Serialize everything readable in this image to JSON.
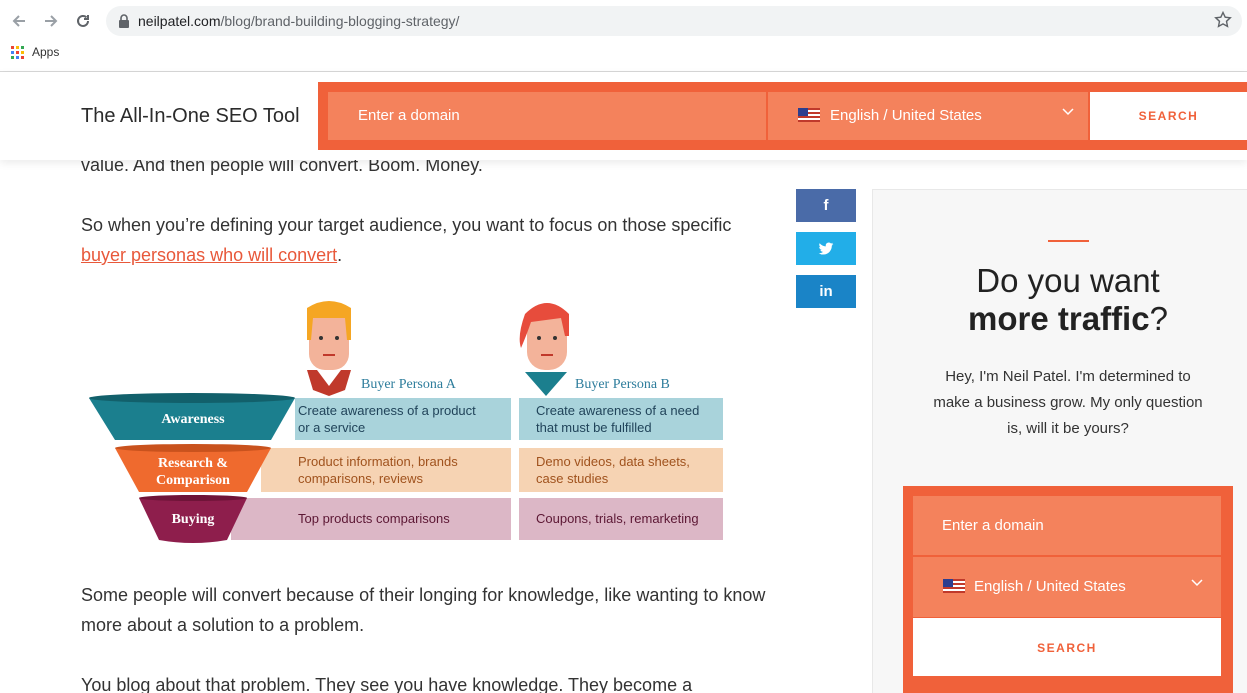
{
  "browser": {
    "url_domain": "neilpatel.com",
    "url_path": "/blog/brand-building-blogging-strategy/",
    "bookmark_apps": "Apps"
  },
  "header": {
    "brand": "The All-In-One SEO Tool",
    "domain_placeholder": "Enter a domain",
    "language": "English / United States",
    "search_label": "SEARCH"
  },
  "article": {
    "p1": "value. And then people will convert. Boom. Money.",
    "p2_text": "So when you’re defining your target audience, you want to focus on those specific ",
    "p2_link": "buyer personas who will convert",
    "p2_end": ".",
    "p3": "Some people will convert because of their longing for knowledge, like wanting to know more about a solution to a problem.",
    "p4": "You blog about that problem. They see you have knowledge. They become a"
  },
  "graphic": {
    "persona_a": "Buyer Persona A",
    "persona_b": "Buyer Persona B",
    "stages": [
      {
        "label_1": "Awareness",
        "label_2": "",
        "a_1": "Create awareness of a product",
        "a_2": "or a service",
        "b_1": "Create awareness of a need",
        "b_2": "that must be fulfilled"
      },
      {
        "label_1": "Research &",
        "label_2": "Comparison",
        "a_1": "Product information, brands",
        "a_2": "comparisons, reviews",
        "b_1": "Demo videos, data sheets,",
        "b_2": "case studies"
      },
      {
        "label_1": "Buying",
        "label_2": "",
        "a_1": "Top products comparisons",
        "a_2": "",
        "b_1": "Coupons, trials, remarketing",
        "b_2": ""
      }
    ],
    "colors": {
      "awareness": "#1b7f8e",
      "awareness_cell": "#a9d3db",
      "research": "#ef6a2e",
      "research_cell": "#f6d3b3",
      "buying": "#8e1e4c",
      "buying_cell": "#dcb7c6"
    }
  },
  "share": {
    "facebook_glyph": "f",
    "linkedin_glyph": "in"
  },
  "sidebar": {
    "title_1": "Do you want",
    "title_bold": "more traffic",
    "title_end": "?",
    "copy": "Hey, I'm Neil Patel. I'm determined to make a business grow. My only question is, will it be yours?",
    "domain_placeholder": "Enter a domain",
    "language": "English / United States",
    "search_label": "SEARCH"
  },
  "colors": {
    "accent": "#f0613a",
    "accent_light": "#f4825c",
    "link": "#e8583a"
  }
}
